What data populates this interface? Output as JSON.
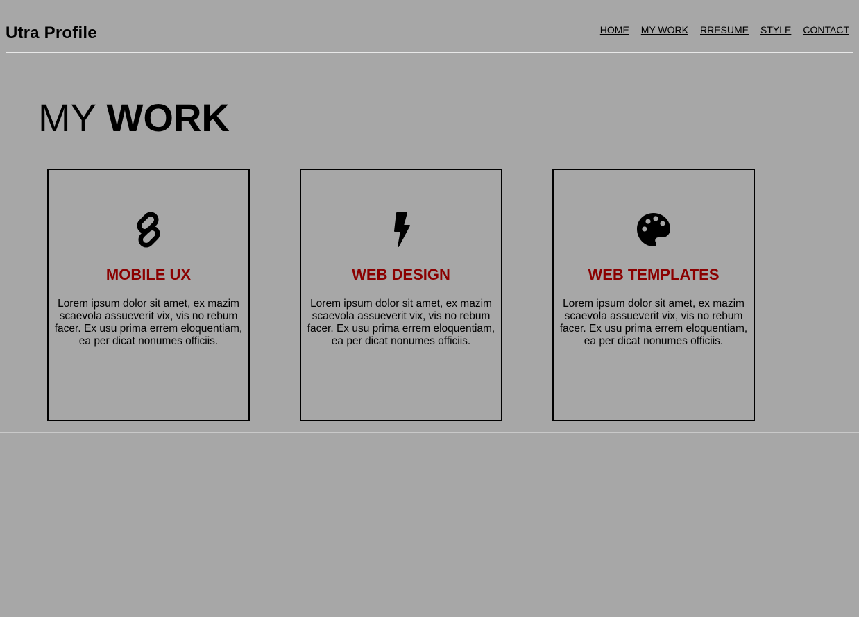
{
  "header": {
    "brand": "Utra Profile",
    "nav": [
      "HOME",
      "MY WORK",
      "RRESUME",
      "STYLE",
      "CONTACT"
    ]
  },
  "main": {
    "title_light": "MY ",
    "title_bold": "WORK",
    "cards": [
      {
        "icon": "link-icon",
        "title": "MOBILE UX",
        "desc": "Lorem ipsum dolor sit amet, ex mazim scaevola assueverit vix, vis no rebum facer. Ex usu prima errem eloquentiam, ea per dicat nonumes officiis."
      },
      {
        "icon": "bolt-icon",
        "title": "WEB DESIGN",
        "desc": "Lorem ipsum dolor sit amet, ex mazim scaevola assueverit vix, vis no rebum facer. Ex usu prima errem eloquentiam, ea per dicat nonumes officiis."
      },
      {
        "icon": "palette-icon",
        "title": "WEB TEMPLATES",
        "desc": "Lorem ipsum dolor sit amet, ex mazim scaevola assueverit vix, vis no rebum facer. Ex usu prima errem eloquentiam, ea per dicat nonumes officiis."
      }
    ]
  },
  "colors": {
    "background": "#a7a7a7",
    "card_title": "#8b0000"
  }
}
